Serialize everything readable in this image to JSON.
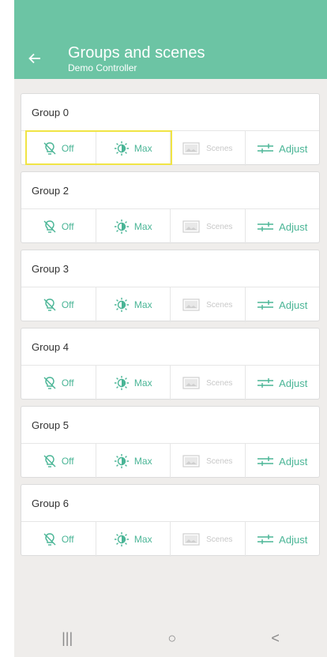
{
  "header": {
    "title": "Groups and scenes",
    "subtitle": "Demo Controller"
  },
  "colors": {
    "accent": "#6cc4a4",
    "action_text": "#4ab596",
    "highlight": "#f0e445"
  },
  "groups": [
    {
      "name": "Group 0"
    },
    {
      "name": "Group 2"
    },
    {
      "name": "Group 3"
    },
    {
      "name": "Group 4"
    },
    {
      "name": "Group 5"
    },
    {
      "name": "Group 6"
    }
  ],
  "actions": {
    "off": "Off",
    "max": "Max",
    "scenes": "Scenes",
    "adjust": "Adjust"
  },
  "icons": {
    "off": "bulb-off-icon",
    "max": "brightness-icon",
    "scenes": "image-icon",
    "adjust": "sliders-icon"
  },
  "navbar": {
    "recents": "|||",
    "home": "○",
    "back": "<"
  }
}
